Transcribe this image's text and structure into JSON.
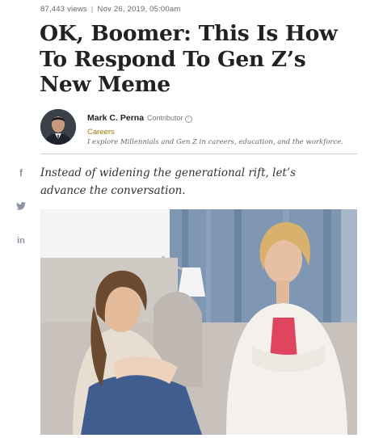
{
  "article": {
    "views": "87,443 views",
    "separator": "|",
    "date": "Nov 26, 2019, 05:00am",
    "headline": "OK, Boomer: This Is How To Respond To Gen Z’s New Meme",
    "standfirst": "Instead of widening the generational rift, let’s advance the conversation."
  },
  "author": {
    "name": "Mark C. Perna",
    "role": "Contributor",
    "info_icon": "i",
    "channel": "Careers",
    "bio": "I explore Millennials and Gen Z in careers, education, and the workforce."
  },
  "share": {
    "facebook_icon": "f",
    "twitter_icon": "twitter-bird",
    "linkedin_icon": "in"
  },
  "colors": {
    "channel_link": "#a57b00",
    "share_icon": "#8b94a3",
    "divider": "#cfcfcf"
  }
}
